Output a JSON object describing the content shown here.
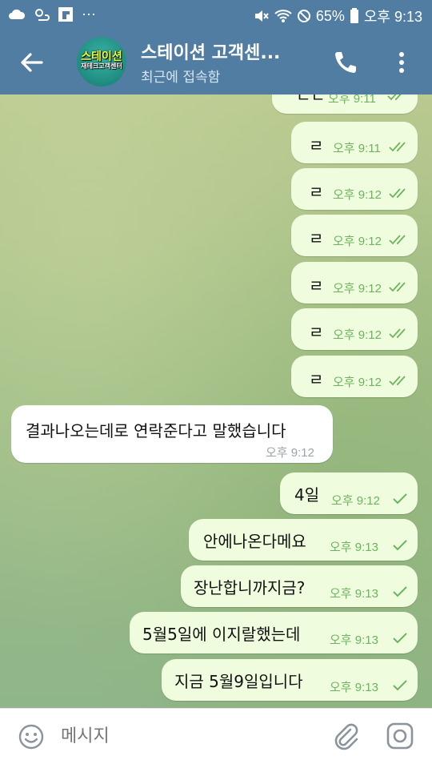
{
  "status_bar": {
    "battery": "65%",
    "time": "오후 9:13",
    "dots": "···"
  },
  "header": {
    "title": "스테이션 고객센...",
    "subtitle": "최근에 접속함",
    "avatar_text_top": "스테이션",
    "avatar_text_bottom": "재테크고객센터"
  },
  "messages": [
    {
      "dir": "out",
      "text": "ㄴㄷ",
      "time": "오후 9:11",
      "status": "read"
    },
    {
      "dir": "out",
      "text": "ㄹ",
      "time": "오후 9:11",
      "status": "read"
    },
    {
      "dir": "out",
      "text": "ㄹ",
      "time": "오후 9:12",
      "status": "read"
    },
    {
      "dir": "out",
      "text": "ㄹ",
      "time": "오후 9:12",
      "status": "read"
    },
    {
      "dir": "out",
      "text": "ㄹ",
      "time": "오후 9:12",
      "status": "read"
    },
    {
      "dir": "out",
      "text": "ㄹ",
      "time": "오후 9:12",
      "status": "read"
    },
    {
      "dir": "out",
      "text": "ㄹ",
      "time": "오후 9:12",
      "status": "read"
    },
    {
      "dir": "in",
      "text": "결과나오는데로 연락준다고 말했습니다",
      "time": "오후 9:12"
    },
    {
      "dir": "out",
      "text": "4일",
      "time": "오후 9:12",
      "status": "sent"
    },
    {
      "dir": "out",
      "text": "안에나온다메요",
      "time": "오후 9:13",
      "status": "sent"
    },
    {
      "dir": "out",
      "text": "장난합니까지금?",
      "time": "오후 9:13",
      "status": "sent"
    },
    {
      "dir": "out",
      "text": "5월5일에 이지랄했는데",
      "time": "오후 9:13",
      "status": "sent"
    },
    {
      "dir": "out",
      "text": "지금 5월9일입니다",
      "time": "오후 9:13",
      "status": "sent"
    }
  ],
  "input": {
    "placeholder": "메시지"
  },
  "colors": {
    "header": "#517da2",
    "outgoing_bubble": "#effdde",
    "incoming_bubble": "#ffffff",
    "check_green": "#6bb45d"
  }
}
